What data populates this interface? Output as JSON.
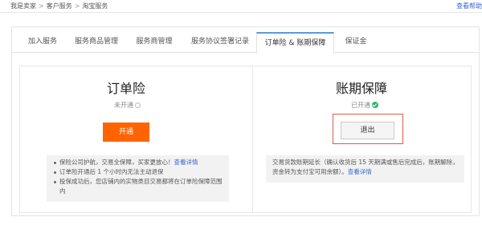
{
  "breadcrumb": [
    "我是卖家",
    "客户服务",
    "淘宝服务"
  ],
  "help_link": "查看帮助",
  "tabs": [
    {
      "label": "加入服务",
      "active": false
    },
    {
      "label": "服务商品管理",
      "active": false
    },
    {
      "label": "服务商管理",
      "active": false
    },
    {
      "label": "服务协议签署记录",
      "active": false
    },
    {
      "label": "订单险 & 账期保障",
      "active": true
    },
    {
      "label": "保证金",
      "active": false
    }
  ],
  "left_card": {
    "title": "订单险",
    "status": "未开通",
    "button": "开通",
    "bullets": [
      {
        "text": "保险公司护航，交易全保障，买家更放心！",
        "link": "查看详情"
      },
      {
        "text": "订单险开通后 1 个小时内无法主动退保",
        "link": ""
      },
      {
        "text": "投保成功后，您店铺内的实物类目交易都将在订单险保障范围内",
        "link": ""
      }
    ]
  },
  "right_card": {
    "title": "账期保障",
    "status": "已开通",
    "button": "退出",
    "info_text": "交易货款账期延长（确认收货后 15 天期满或售后完成后，账期解除，资金转为支付宝可用余额）。",
    "info_link": "查看详情"
  },
  "colors": {
    "accent": "#ff6400",
    "link": "#3366cc",
    "success": "#2fb37a",
    "highlight_border": "#e05a4a"
  }
}
